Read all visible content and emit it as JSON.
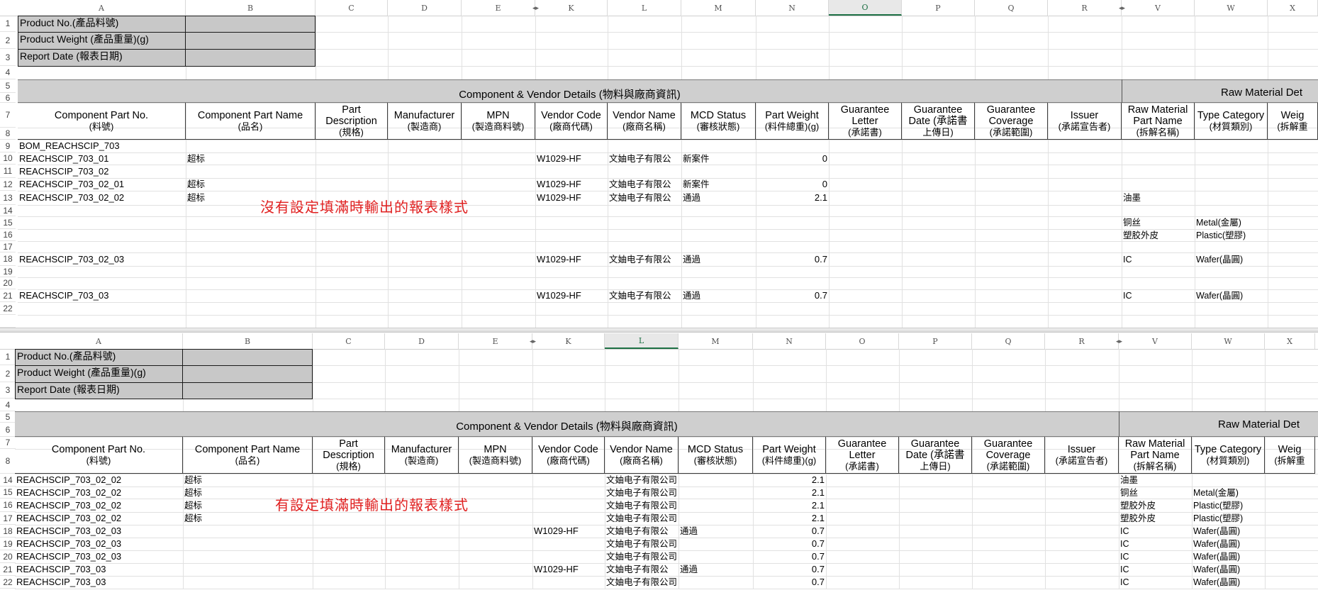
{
  "columns_top": [
    "A",
    "B",
    "C",
    "D",
    "E",
    "K",
    "L",
    "M",
    "N",
    "O",
    "P",
    "Q",
    "R",
    "V",
    "W",
    "X"
  ],
  "columns_bottom": [
    "A",
    "B",
    "C",
    "D",
    "E",
    "K",
    "L",
    "M",
    "N",
    "O",
    "P",
    "Q",
    "R",
    "V",
    "W",
    "X"
  ],
  "info": {
    "product_no": "Product No.(產品料號)",
    "product_weight": "Product Weight (產品重量)(g)",
    "report_date": "Report Date (報表日期)"
  },
  "band": {
    "component_vendor": "Component & Vendor Details (物料與廠商資訊)",
    "raw_material": "Raw Material Det"
  },
  "headers": [
    {
      "en": "Component Part No.",
      "zh": "(料號)"
    },
    {
      "en": "Component Part Name",
      "zh": "(品名)"
    },
    {
      "en": "Part Description",
      "zh": "(規格)"
    },
    {
      "en": "Manufacturer",
      "zh": "(製造商)"
    },
    {
      "en": "MPN",
      "zh": "(製造商料號)"
    },
    {
      "en": "Vendor Code",
      "zh": "(廠商代碼)"
    },
    {
      "en": "Vendor Name",
      "zh": "(廠商名稱)"
    },
    {
      "en": "MCD Status",
      "zh": "(審核狀態)"
    },
    {
      "en": "Part Weight",
      "zh": "(料件總重)(g)"
    },
    {
      "en": "Guarantee Letter",
      "zh": "(承諾書)"
    },
    {
      "en": "Guarantee Date (承諾書",
      "zh": "上傳日)"
    },
    {
      "en": "Guarantee Coverage",
      "zh": "(承諾範圍)"
    },
    {
      "en": "Issuer",
      "zh": "(承諾宣告者)"
    },
    {
      "en": "Raw Material Part Name",
      "zh": "(拆解名稱)"
    },
    {
      "en": "Type Category",
      "zh": "(材質類別)"
    },
    {
      "en": "Weig",
      "zh": "(拆解重"
    }
  ],
  "top_rows": [
    {
      "row": "9",
      "a": "BOM_REACHSCIP_703",
      "b": "",
      "k": "",
      "l": "",
      "m": "",
      "n": "",
      "v": "",
      "w": ""
    },
    {
      "row": "10",
      "a": "REACHSCIP_703_01",
      "b": "超标",
      "k": "W1029-HF",
      "l": "文妯电子有限公",
      "m": "新案件",
      "n": "0",
      "v": "",
      "w": ""
    },
    {
      "row": "11",
      "a": "REACHSCIP_703_02",
      "b": "",
      "k": "",
      "l": "",
      "m": "",
      "n": "",
      "v": "",
      "w": ""
    },
    {
      "row": "12",
      "a": "REACHSCIP_703_02_01",
      "b": "超标",
      "k": "W1029-HF",
      "l": "文妯电子有限公",
      "m": "新案件",
      "n": "0",
      "v": "",
      "w": ""
    },
    {
      "row": "13",
      "a": "REACHSCIP_703_02_02",
      "b": "超标",
      "k": "W1029-HF",
      "l": "文妯电子有限公",
      "m": "通過",
      "n": "2.1",
      "v": "油墨",
      "w": ""
    },
    {
      "row": "14",
      "a": "",
      "b": "",
      "k": "",
      "l": "",
      "m": "",
      "n": "",
      "v": "",
      "w": ""
    },
    {
      "row": "15",
      "a": "",
      "b": "",
      "k": "",
      "l": "",
      "m": "",
      "n": "",
      "v": "铜丝",
      "w": "Metal(金屬)"
    },
    {
      "row": "16",
      "a": "",
      "b": "",
      "k": "",
      "l": "",
      "m": "",
      "n": "",
      "v": "塑胶外皮",
      "w": "Plastic(塑膠)"
    },
    {
      "row": "17",
      "a": "",
      "b": "",
      "k": "",
      "l": "",
      "m": "",
      "n": "",
      "v": "",
      "w": ""
    },
    {
      "row": "18",
      "a": "REACHSCIP_703_02_03",
      "b": "",
      "k": "W1029-HF",
      "l": "文妯电子有限公",
      "m": "通過",
      "n": "0.7",
      "v": "IC",
      "w": "Wafer(晶圓)"
    },
    {
      "row": "19",
      "a": "",
      "b": "",
      "k": "",
      "l": "",
      "m": "",
      "n": "",
      "v": "",
      "w": ""
    },
    {
      "row": "20",
      "a": "",
      "b": "",
      "k": "",
      "l": "",
      "m": "",
      "n": "",
      "v": "",
      "w": ""
    },
    {
      "row": "21",
      "a": "REACHSCIP_703_03",
      "b": "",
      "k": "W1029-HF",
      "l": "文妯电子有限公",
      "m": "通過",
      "n": "0.7",
      "v": "IC",
      "w": "Wafer(晶圓)"
    },
    {
      "row": "22",
      "a": "",
      "b": "",
      "k": "",
      "l": "",
      "m": "",
      "n": "",
      "v": "",
      "w": ""
    }
  ],
  "bottom_rows": [
    {
      "row": "14",
      "a": "REACHSCIP_703_02_02",
      "b": "超标",
      "k": "",
      "l": "文妯电子有限公司",
      "m": "",
      "n": "2.1",
      "v": "油墨",
      "w": ""
    },
    {
      "row": "15",
      "a": "REACHSCIP_703_02_02",
      "b": "超标",
      "k": "",
      "l": "文妯电子有限公司",
      "m": "",
      "n": "2.1",
      "v": "铜丝",
      "w": "Metal(金屬)"
    },
    {
      "row": "16",
      "a": "REACHSCIP_703_02_02",
      "b": "超标",
      "k": "",
      "l": "文妯电子有限公司",
      "m": "",
      "n": "2.1",
      "v": "塑胶外皮",
      "w": "Plastic(塑膠)"
    },
    {
      "row": "17",
      "a": "REACHSCIP_703_02_02",
      "b": "超标",
      "k": "",
      "l": "文妯电子有限公司",
      "m": "",
      "n": "2.1",
      "v": "塑胶外皮",
      "w": "Plastic(塑膠)"
    },
    {
      "row": "18",
      "a": "REACHSCIP_703_02_03",
      "b": "",
      "k": "W1029-HF",
      "l": "文妯电子有限公",
      "m": "通過",
      "n": "0.7",
      "v": "IC",
      "w": "Wafer(晶圓)"
    },
    {
      "row": "19",
      "a": "REACHSCIP_703_02_03",
      "b": "",
      "k": "",
      "l": "文妯电子有限公司",
      "m": "",
      "n": "0.7",
      "v": "IC",
      "w": "Wafer(晶圓)"
    },
    {
      "row": "20",
      "a": "REACHSCIP_703_02_03",
      "b": "",
      "k": "",
      "l": "文妯电子有限公司",
      "m": "",
      "n": "0.7",
      "v": "IC",
      "w": "Wafer(晶圓)"
    },
    {
      "row": "21",
      "a": "REACHSCIP_703_03",
      "b": "",
      "k": "W1029-HF",
      "l": "文妯电子有限公",
      "m": "通過",
      "n": "0.7",
      "v": "IC",
      "w": "Wafer(晶圓)"
    },
    {
      "row": "22",
      "a": "REACHSCIP_703_03",
      "b": "",
      "k": "",
      "l": "文妯电子有限公司",
      "m": "",
      "n": "0.7",
      "v": "IC",
      "w": "Wafer(晶圓)"
    }
  ],
  "annotations": {
    "top": "沒有設定填滿時輸出的報表樣式",
    "bottom": "有設定填滿時輸出的報表樣式"
  },
  "colors": {
    "annotation": "#e02020",
    "header_fill": "#cfcfcf",
    "selected_col": "#1e7145"
  }
}
